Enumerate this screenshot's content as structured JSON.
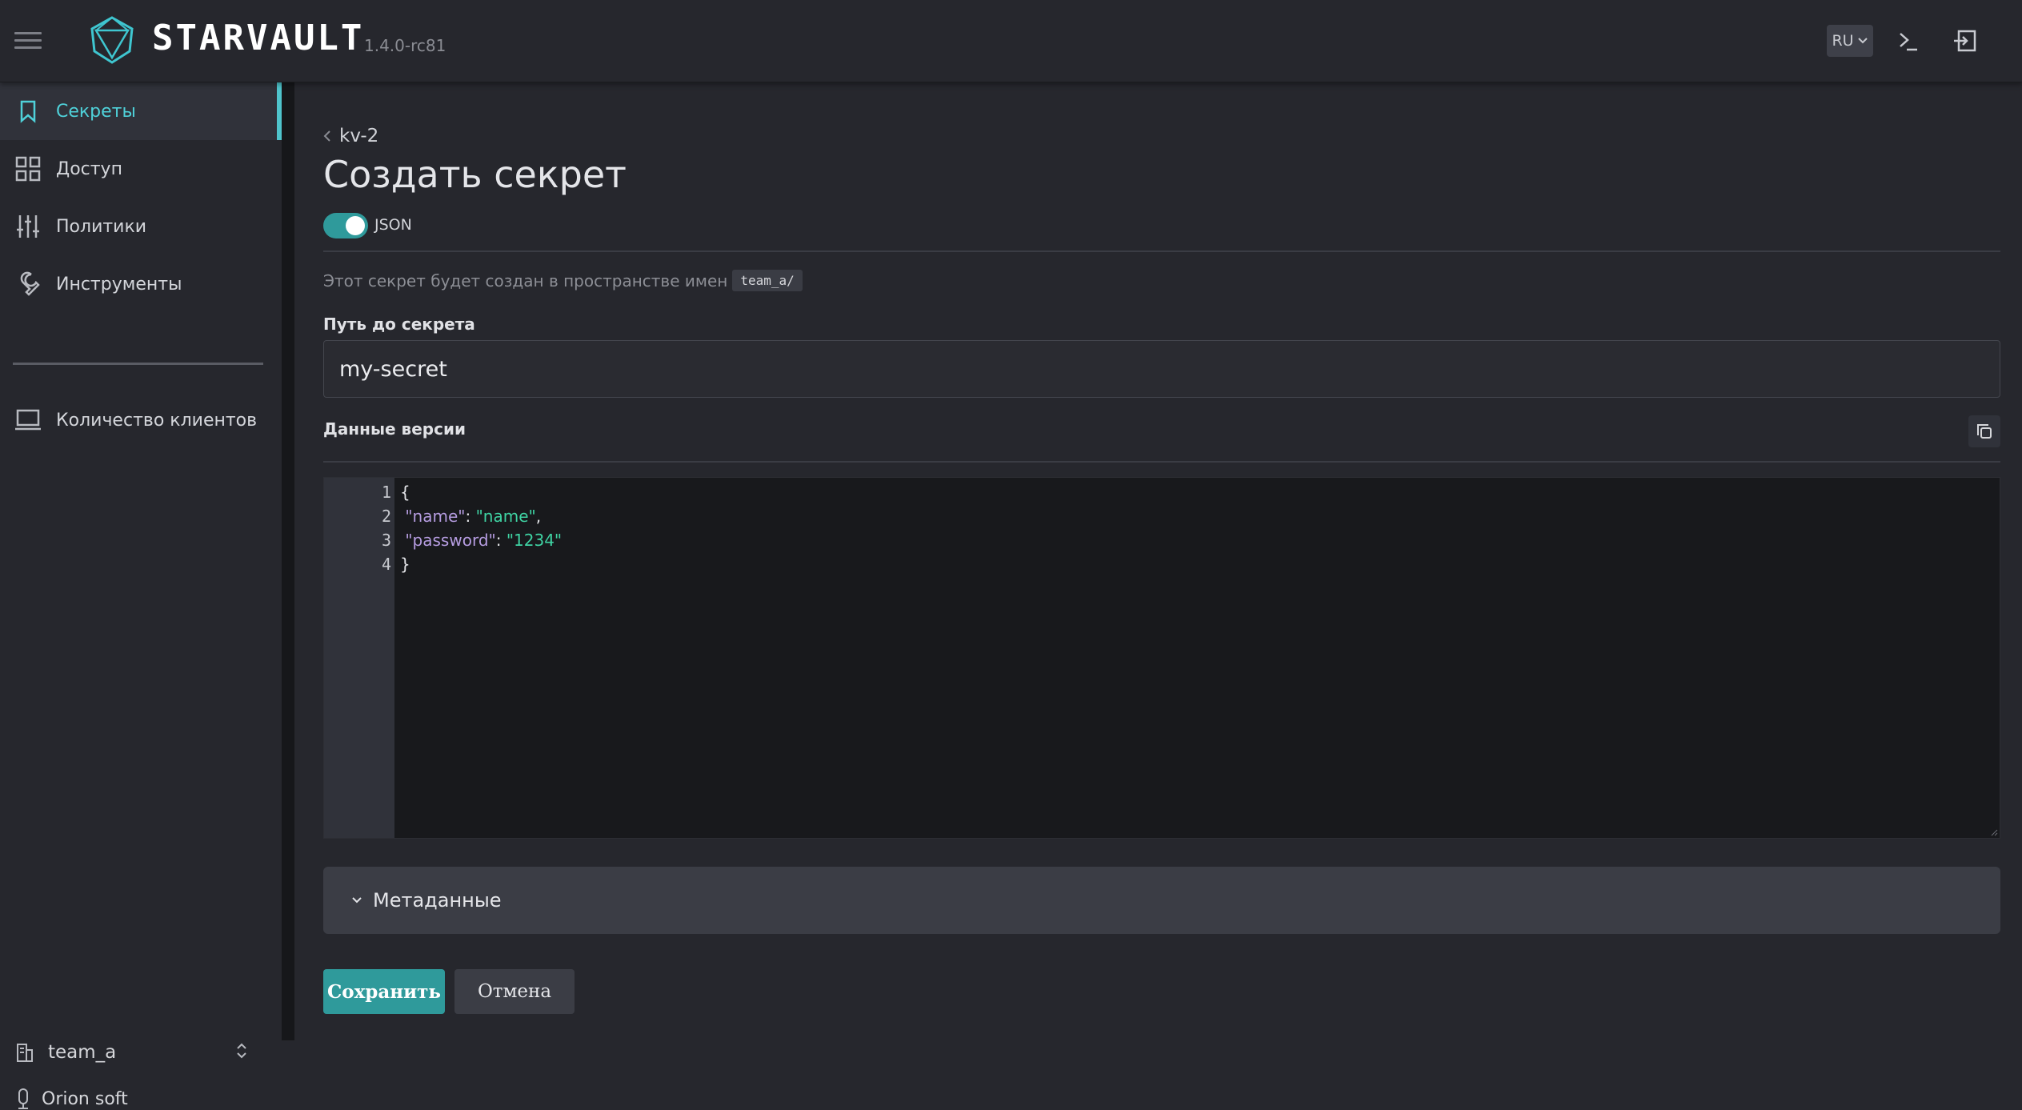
{
  "header": {
    "brand": "STARVAULT",
    "version": "1.4.0-rc81",
    "language": "RU",
    "icons": [
      "menu-icon",
      "starvault-logo-icon",
      "chevron-down-icon",
      "console-icon",
      "logout-icon"
    ]
  },
  "sidebar": {
    "items": [
      {
        "label": "Секреты",
        "icon": "bookmark-icon",
        "active": true
      },
      {
        "label": "Доступ",
        "icon": "grid-icon",
        "active": false
      },
      {
        "label": "Политики",
        "icon": "sliders-icon",
        "active": false
      },
      {
        "label": "Инструменты",
        "icon": "wrench-icon",
        "active": false
      }
    ],
    "extra_item": {
      "label": "Количество клиентов",
      "icon": "laptop-icon"
    },
    "namespace": "team_a",
    "org": "Orion soft"
  },
  "main": {
    "breadcrumb": "kv-2",
    "title": "Создать секрет",
    "toggle_label": "JSON",
    "toggle_on": true,
    "namespace_note": "Этот секрет будет создан в пространстве имен",
    "namespace_chip": "team_a/",
    "path_label": "Путь до секрета",
    "path_value": "my-secret",
    "version_label": "Данные версии",
    "editor": {
      "line_numbers": [
        "1",
        "2",
        "3",
        "4"
      ],
      "lines": [
        {
          "text": "{"
        },
        {
          "key": "\"name\"",
          "sep": ": ",
          "value": "\"name\"",
          "end": ","
        },
        {
          "key": "\"password\"",
          "sep": ": ",
          "value": "\"1234\"",
          "end": ""
        },
        {
          "text": "}"
        }
      ]
    },
    "metadata_label": "Метаданные",
    "save_label": "Сохранить",
    "cancel_label": "Отмена"
  },
  "colors": {
    "accent": "#2f9a9b",
    "active_text": "#4fd1d9",
    "json_key": "#b59ce0",
    "json_string": "#3fd3a3",
    "background": "#26272d"
  }
}
